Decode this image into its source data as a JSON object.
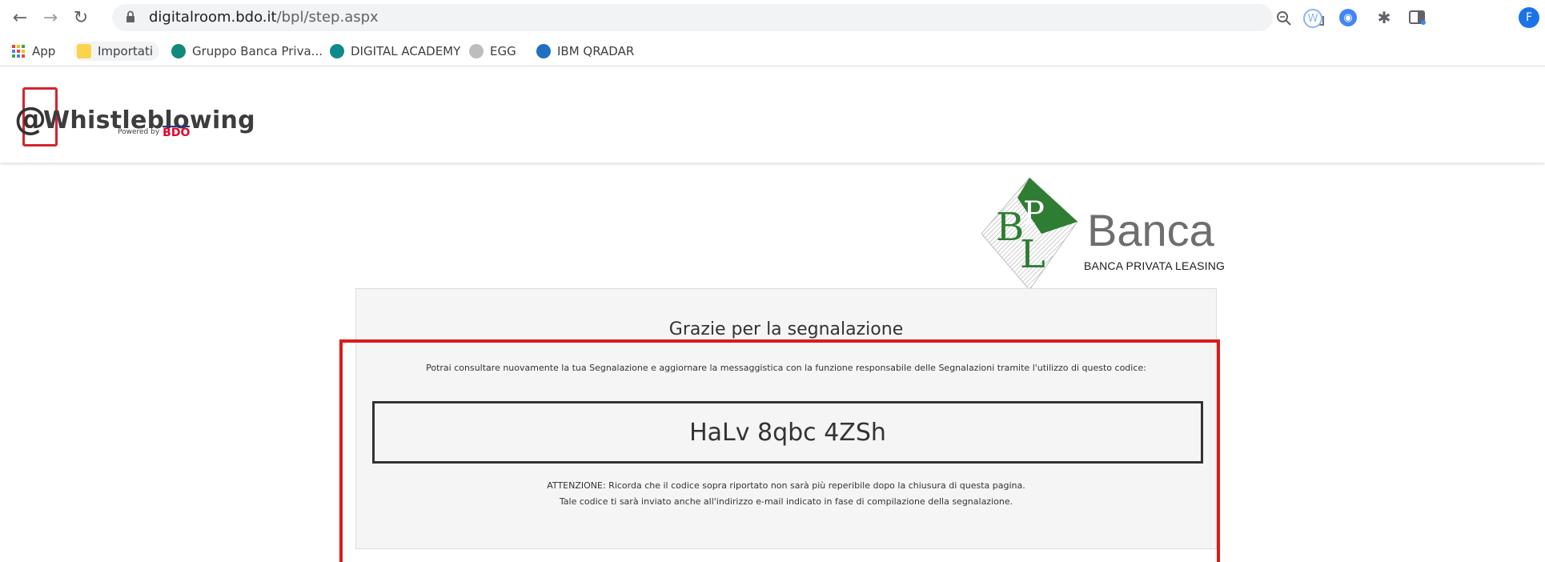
{
  "browser": {
    "url_host": "digitalroom.bdo.it",
    "url_path": "/bpl/step.aspx",
    "profile_initial": "F"
  },
  "bookmarks": [
    {
      "label": "App"
    },
    {
      "label": "Importati"
    },
    {
      "label": "Gruppo Banca Priva..."
    },
    {
      "label": "DIGITAL ACADEMY"
    },
    {
      "label": "EGG"
    },
    {
      "label": "IBM QRADAR"
    }
  ],
  "site": {
    "logo_at": "@",
    "logo_text": "Whistleblowing",
    "powered_by": "Powered by",
    "powered_brand": "BDO"
  },
  "bank": {
    "mark": "BPL",
    "name": "Banca",
    "subtitle": "BANCA PRIVATA LEASING"
  },
  "panel": {
    "title": "Grazie per la segnalazione",
    "info": "Potrai consultare nuovamente la tua Segnalazione e aggiornare la messaggistica con la funzione responsabile delle Segnalazioni tramite l'utilizzo di questo codice:",
    "code": "HaLv 8qbc 4ZSh",
    "warning_line1": "ATTENZIONE: Ricorda che il codice sopra riportato non sarà più reperibile dopo la chiusura di questa pagina.",
    "warning_line2": "Tale codice ti sarà inviato anche all'indirizzo e-mail indicato in fase di compilazione della segnalazione."
  },
  "colors": {
    "highlight": "#d91c1c",
    "bank_green": "#2e7d32",
    "bdo_red": "#e4002b"
  }
}
